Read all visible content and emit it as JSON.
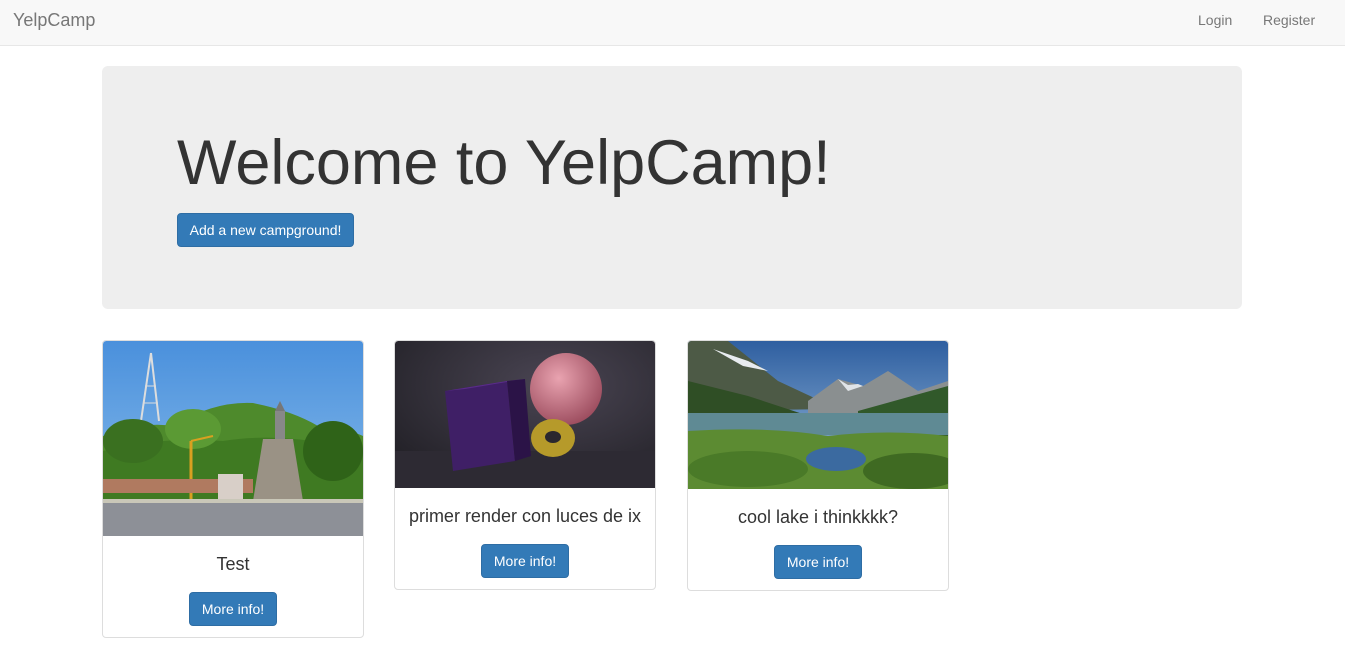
{
  "navbar": {
    "brand": "YelpCamp",
    "login": "Login",
    "register": "Register"
  },
  "jumbotron": {
    "title": "Welcome to YelpCamp!",
    "add_button": "Add a new campground!"
  },
  "campgrounds": [
    {
      "name": "Test",
      "button": "More info!",
      "image": "hill-with-tower-and-road"
    },
    {
      "name": "primer render con luces de ix",
      "button": "More info!",
      "image": "3d-render-cube-sphere-donut"
    },
    {
      "name": "cool lake i thinkkkk?",
      "button": "More info!",
      "image": "mountain-lake-landscape"
    }
  ],
  "colors": {
    "primary": "#337ab7",
    "navbar_bg": "#f8f8f8",
    "jumbotron_bg": "#eeeeee"
  }
}
